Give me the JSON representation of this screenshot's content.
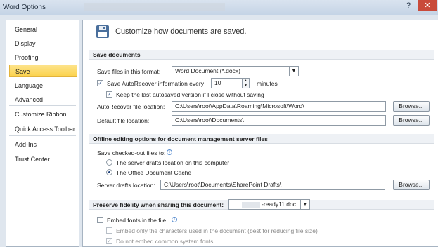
{
  "window": {
    "title": "Word Options",
    "help_icon": "help-icon",
    "close_icon": "close-icon"
  },
  "sidebar": {
    "items": [
      {
        "label": "General"
      },
      {
        "label": "Display"
      },
      {
        "label": "Proofing"
      },
      {
        "label": "Save",
        "selected": true
      },
      {
        "label": "Language"
      },
      {
        "label": "Advanced"
      },
      {
        "label": "Customize Ribbon"
      },
      {
        "label": "Quick Access Toolbar"
      },
      {
        "label": "Add-Ins"
      },
      {
        "label": "Trust Center"
      }
    ]
  },
  "header": {
    "text": "Customize how documents are saved."
  },
  "save_documents": {
    "section_title": "Save documents",
    "format_label": "Save files in this format:",
    "format_value": "Word Document (*.docx)",
    "autorecover_label": "Save AutoRecover information every",
    "autorecover_checked": true,
    "autorecover_minutes": "10",
    "minutes_label": "minutes",
    "keep_last_label": "Keep the last autosaved version if I close without saving",
    "keep_last_checked": true,
    "autorecover_location_label": "AutoRecover file location:",
    "autorecover_location_value": "C:\\Users\\root\\AppData\\Roaming\\Microsoft\\Word\\",
    "default_location_label": "Default file location:",
    "default_location_value": "C:\\Users\\root\\Documents\\",
    "browse_label": "Browse..."
  },
  "offline": {
    "section_title": "Offline editing options for document management server files",
    "checked_out_label": "Save checked-out files to:",
    "radio_server": "The server drafts location on this computer",
    "radio_cache": "The Office Document Cache",
    "server_drafts_label": "Server drafts location:",
    "server_drafts_value": "C:\\Users\\root\\Documents\\SharePoint Drafts\\",
    "browse_label": "Browse..."
  },
  "fidelity": {
    "section_title": "Preserve fidelity when sharing this document:",
    "document_value": "-ready11.doc",
    "embed_fonts_label": "Embed fonts in the file",
    "embed_fonts_checked": false,
    "embed_chars_label": "Embed only the characters used in the document (best for reducing file size)",
    "no_common_label": "Do not embed common system fonts",
    "no_common_checked": true
  }
}
